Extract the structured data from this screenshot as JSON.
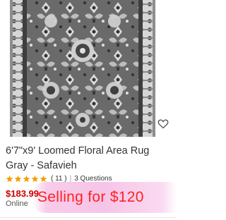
{
  "product": {
    "title": "6'7\"x9' Loomed Floral Area Rug Gray - Safavieh",
    "image_alt": "Gray floral rug",
    "rating_stars": 5,
    "rating_count": "( 11 )",
    "separator": "|",
    "questions": "3 Questions",
    "price": "$183.99",
    "availability": "Online"
  },
  "overlay": {
    "text": "Selling for $120",
    "text_color": "#ff2222",
    "highlight_color": "#f6c4e8"
  },
  "colors": {
    "star": "#f4a000",
    "price": "#cc0000",
    "rug_base": "#6e6e6e",
    "rug_border": "#d8d8d8"
  },
  "icons": {
    "favorite": "heart-outline-icon",
    "star": "star-icon"
  }
}
